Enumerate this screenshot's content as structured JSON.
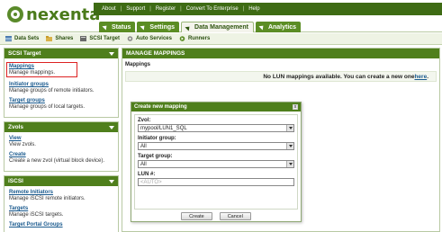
{
  "brand": {
    "name": "nexenta"
  },
  "topnav": {
    "items": [
      "About",
      "Support",
      "Register",
      "Convert To Enterprise",
      "Help"
    ]
  },
  "tabs": [
    {
      "label": "Status"
    },
    {
      "label": "Settings"
    },
    {
      "label": "Data Management"
    },
    {
      "label": "Analytics"
    }
  ],
  "subnav": {
    "items": [
      "Data Sets",
      "Shares",
      "SCSI Target",
      "Auto Services",
      "Runners"
    ]
  },
  "sidebar": {
    "scsi_target": {
      "title": "SCSI Target",
      "entries": [
        {
          "link": "Mappings",
          "desc": "Manage mappings."
        },
        {
          "link": "Initiator groups",
          "desc": "Manage groups of remote initiators."
        },
        {
          "link": "Target groups",
          "desc": "Manage groups of local targets."
        }
      ]
    },
    "zvols": {
      "title": "Zvols",
      "entries": [
        {
          "link": "View",
          "desc": "View zvols."
        },
        {
          "link": "Create",
          "desc": "Create a new zvol (virtual block device)."
        }
      ]
    },
    "iscsi": {
      "title": "iSCSI",
      "entries": [
        {
          "link": "Remote Initiators",
          "desc": "Manage iSCSI remote initiators."
        },
        {
          "link": "Targets",
          "desc": "Manage iSCSI targets."
        },
        {
          "link": "Target Portal Groups",
          "desc": ""
        }
      ]
    }
  },
  "main": {
    "header": "MANAGE MAPPINGS",
    "section": "Mappings",
    "notice_text": "No LUN mappings available. You can create a new one ",
    "notice_link": "here",
    "notice_end": "."
  },
  "dialog": {
    "title": "Create new mapping",
    "close": "x",
    "zvol_label": "Zvol:",
    "zvol_value": "mypool/LUN1_SQL",
    "initiator_label": "Initiator group:",
    "initiator_value": "All",
    "target_label": "Target group:",
    "target_value": "All",
    "lun_label": "LUN #:",
    "lun_placeholder": "<AUTO>",
    "create_label": "Create",
    "cancel_label": "Cancel"
  }
}
